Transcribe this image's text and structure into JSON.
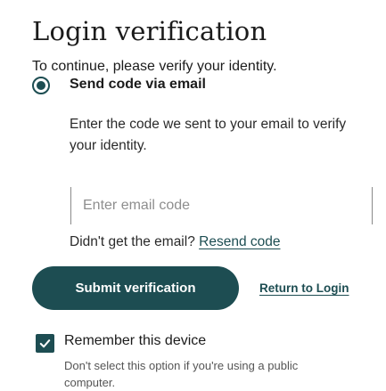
{
  "header": {
    "title": "Login verification",
    "subtitle": "To continue, please verify your identity."
  },
  "method": {
    "selected": true,
    "label": "Send code via email",
    "instructions": "Enter the code we sent to your email to verify your identity."
  },
  "code_input": {
    "placeholder": "Enter email code",
    "value": ""
  },
  "resend": {
    "prompt": "Didn't get the email?",
    "link_label": "Resend code"
  },
  "actions": {
    "submit_label": "Submit verification",
    "return_label": "Return to Login"
  },
  "remember": {
    "checked": true,
    "label": "Remember this device",
    "help": "Don't select this option if you're using a public computer."
  },
  "colors": {
    "accent": "#1d4d52",
    "text": "#1b1b1b",
    "muted": "#555555",
    "placeholder": "#8e8e8e"
  },
  "icons": {
    "radio": "radio-selected-icon",
    "checkbox": "checkmark-icon"
  }
}
